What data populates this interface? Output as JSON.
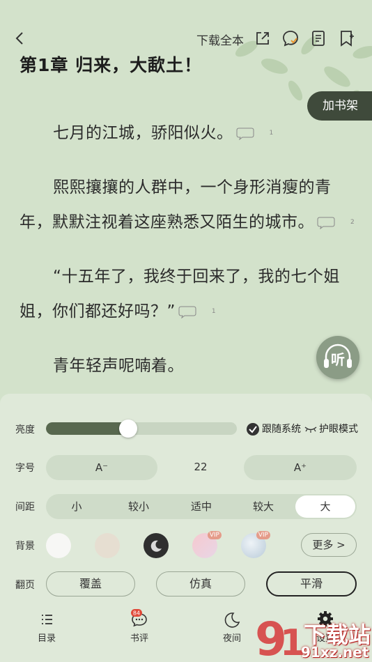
{
  "topbar": {
    "download_label": "下载全本"
  },
  "chapter": {
    "title": "第1章 归来，大歃土！"
  },
  "shelf_button": "加书架",
  "paragraphs": [
    {
      "text": "七月的江城，骄阳似火。",
      "comments": "1"
    },
    {
      "text": "熙熙攘攘的人群中，一个身形消瘦的青年，默默注视着这座熟悉又陌生的城市。",
      "comments": "2"
    },
    {
      "text": "“十五年了，我终于回来了，我的七个姐姐，你们都还好吗？”",
      "comments": "1"
    },
    {
      "text": "青年轻声呢喃着。",
      "comments": ""
    }
  ],
  "listen_button": "听",
  "settings": {
    "brightness": {
      "label": "亮度",
      "level": 0.43,
      "follow_system": "跟随系统",
      "eye_mode": "护眼模式"
    },
    "font_size": {
      "label": "字号",
      "decrease": "A⁻",
      "value": "22",
      "increase": "A⁺"
    },
    "spacing": {
      "label": "间距",
      "options": [
        "小",
        "较小",
        "适中",
        "较大",
        "大"
      ],
      "selected": "大"
    },
    "background": {
      "label": "背景",
      "vip_badge": "VIP",
      "more": "更多 >"
    },
    "page_turn": {
      "label": "翻页",
      "options": [
        "覆盖",
        "仿真",
        "平滑"
      ],
      "selected": "平滑"
    }
  },
  "bottom_nav": {
    "items": [
      {
        "label": "目录",
        "icon": "list-icon"
      },
      {
        "label": "书评",
        "icon": "comment-icon",
        "badge": "84"
      },
      {
        "label": "夜间",
        "icon": "moon-icon"
      },
      {
        "label": "设置",
        "icon": "gear-icon"
      }
    ]
  },
  "watermark": {
    "text": "下载站",
    "url": "91xz.net"
  },
  "colors": {
    "page_bg": "#d3e2cb",
    "panel_bg": "#dfe9d9",
    "accent": "#3f4a3b",
    "slider_fill": "#58684f"
  }
}
